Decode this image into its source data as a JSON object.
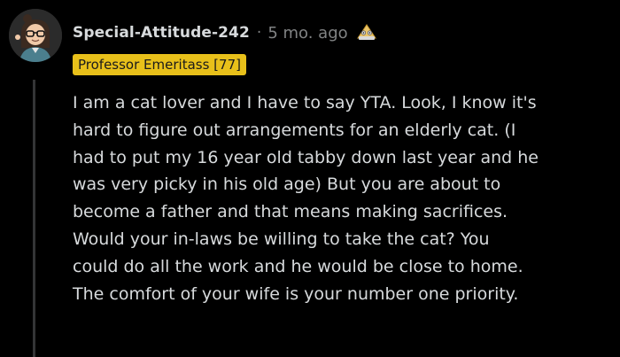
{
  "comment": {
    "username": "Special-Attitude-242",
    "separator": "·",
    "timestamp": "5 mo. ago",
    "award_icon": "helpful-award-icon",
    "flair": "Professor Emeritass [77]",
    "flair_color": "#e8c01a",
    "body_lines": [
      "I am a cat lover and I have to say YTA. Look, I know it's",
      "hard to figure out arrangements for an elderly cat. (I",
      "had to put my 16 year old tabby down last year and he",
      "was very picky in his old age) But you are about to",
      "become a father and that means making sacrifices.",
      "Would your in-laws be willing to take the cat? You",
      "could do all the work and he would be close to home.",
      "The comfort of your wife is your number one priority."
    ]
  },
  "colors": {
    "background": "#000000",
    "text": "#d7dadc",
    "meta": "#818384",
    "thread_line": "#343536"
  }
}
